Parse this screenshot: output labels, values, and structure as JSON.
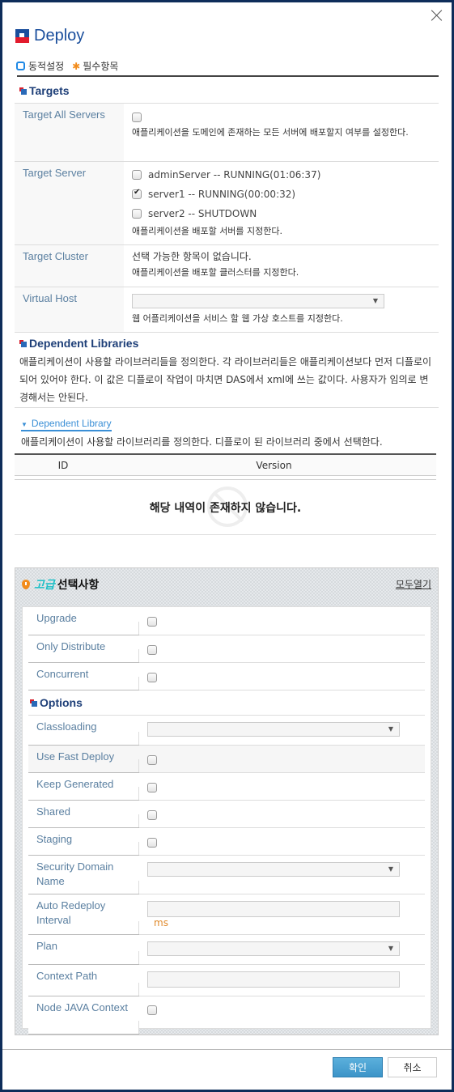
{
  "dialog": {
    "title": "Deploy",
    "legend": {
      "dynamic_label": "동적설정",
      "required_label": "필수항목"
    }
  },
  "targets": {
    "title": "Targets",
    "rows": {
      "all_servers": {
        "label": "Target All Servers",
        "checked": false,
        "desc": "애플리케이션을 도메인에 존재하는 모든 서버에 배포할지 여부를 설정한다."
      },
      "server": {
        "label": "Target Server",
        "servers": [
          {
            "name": "adminServer -- RUNNING(01:06:37)",
            "checked": false
          },
          {
            "name": "server1 -- RUNNING(00:00:32)",
            "checked": true
          },
          {
            "name": "server2 -- SHUTDOWN",
            "checked": false
          }
        ],
        "desc": "애플리케이션을 배포할 서버를 지정한다."
      },
      "cluster": {
        "label": "Target Cluster",
        "empty": "선택 가능한 항목이 없습니다.",
        "desc": "애플리케이션을 배포할 클러스터를 지정한다."
      },
      "virtual_host": {
        "label": "Virtual Host",
        "value": "",
        "desc": "웹 어플리케이션을 서비스 할 웹 가상 호스트를 지정한다."
      }
    }
  },
  "dependent_libraries": {
    "title": "Dependent Libraries",
    "desc": "애플리케이션이 사용할 라이브러리들을 정의한다. 각 라이브러리들은 애플리케이션보다 먼저 디플로이 되어 있어야 한다. 이 값은 디플로이 작업이 마치면 DAS에서 xml에 쓰는 값이다. 사용자가 임의로 변경해서는 안된다.",
    "sub": {
      "link": "Dependent Library",
      "desc": "애플리케이션이 사용할 라이브러리를 정의한다. 디플로이 된 라이브러리 중에서 선택한다.",
      "columns": [
        "ID",
        "Version"
      ],
      "rows": [],
      "empty_text": "해당 내역이 존재하지 않습니다."
    }
  },
  "advanced": {
    "title_highlight": "고급",
    "title_rest": "선택사항",
    "open_all": "모두열기",
    "rows": {
      "upgrade": {
        "label": "Upgrade",
        "checked": false
      },
      "only_distribute": {
        "label": "Only Distribute",
        "checked": false
      },
      "concurrent": {
        "label": "Concurrent",
        "checked": false
      }
    },
    "options": {
      "title": "Options",
      "classloading": {
        "label": "Classloading",
        "value": ""
      },
      "use_fast_deploy": {
        "label": "Use Fast Deploy",
        "checked": false
      },
      "keep_generated": {
        "label": "Keep Generated",
        "checked": false
      },
      "shared": {
        "label": "Shared",
        "checked": false
      },
      "staging": {
        "label": "Staging",
        "checked": false
      },
      "security_domain": {
        "label": "Security Domain Name",
        "value": ""
      },
      "auto_redeploy": {
        "label": "Auto Redeploy Interval",
        "value": "",
        "unit": "ms"
      },
      "plan": {
        "label": "Plan",
        "value": ""
      },
      "context_path": {
        "label": "Context Path",
        "value": ""
      },
      "node_java_context": {
        "label": "Node JAVA Context",
        "checked": false
      }
    }
  },
  "footer": {
    "ok": "확인",
    "cancel": "취소"
  },
  "colors": {
    "brand": "#1a4e9c",
    "accent_red": "#e21b2d",
    "ok_button": "#3c94c8",
    "unit": "#e08a2c",
    "highlight": "#1bbfc7"
  }
}
